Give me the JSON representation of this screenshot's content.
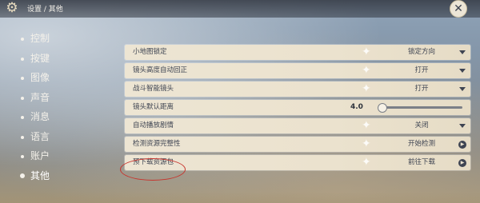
{
  "header": {
    "gear_icon": "gear-icon",
    "breadcrumb": "设置 / 其他",
    "close_icon": "close-icon",
    "close_glyph": "✕"
  },
  "sidebar": {
    "items": [
      {
        "label": "控制"
      },
      {
        "label": "按键"
      },
      {
        "label": "图像"
      },
      {
        "label": "声音"
      },
      {
        "label": "消息"
      },
      {
        "label": "语言"
      },
      {
        "label": "账户"
      },
      {
        "label": "其他",
        "active": true
      }
    ]
  },
  "settings": [
    {
      "label": "小地图锁定",
      "value": "锁定方向",
      "control": "dropdown"
    },
    {
      "label": "镜头高度自动回正",
      "value": "打开",
      "control": "dropdown"
    },
    {
      "label": "战斗智能镜头",
      "value": "打开",
      "control": "dropdown"
    },
    {
      "label": "镜头默认距离",
      "value": "4.0",
      "control": "slider",
      "slider_fraction": 0.0
    },
    {
      "label": "自动播放剧情",
      "value": "关闭",
      "control": "dropdown"
    },
    {
      "label": "检测资源完整性",
      "value": "开始检测",
      "control": "action"
    },
    {
      "label": "预下载资源包",
      "value": "前往下载",
      "control": "action"
    }
  ],
  "colors": {
    "row_bg": "#ede5d3",
    "row_text": "#3e4452",
    "highlight": "#c7342d"
  }
}
